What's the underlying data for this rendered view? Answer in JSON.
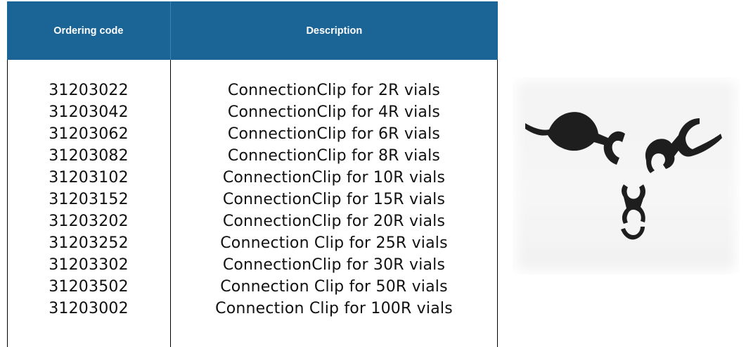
{
  "table": {
    "headers": {
      "ordering_code": "Ordering code",
      "description": "Description"
    },
    "rows": [
      {
        "code": "31203022",
        "description": "ConnectionClip for 2R vials"
      },
      {
        "code": "31203042",
        "description": "ConnectionClip for 4R vials"
      },
      {
        "code": "31203062",
        "description": "ConnectionClip for 6R vials"
      },
      {
        "code": "31203082",
        "description": "ConnectionClip for 8R vials"
      },
      {
        "code": "31203102",
        "description": "ConnectionClip for 10R vials"
      },
      {
        "code": "31203152",
        "description": "ConnectionClip for 15R vials"
      },
      {
        "code": "31203202",
        "description": "ConnectionClip for 20R vials"
      },
      {
        "code": "31203252",
        "description": "Connection Clip for 25R vials"
      },
      {
        "code": "31203302",
        "description": "ConnectionClip for 30R vials"
      },
      {
        "code": "31203502",
        "description": "Connection Clip for 50R vials"
      },
      {
        "code": "31203002",
        "description": "Connection Clip for 100R vials"
      }
    ]
  },
  "image": {
    "subject": "connection-clips-photo",
    "icon": "connection-clip-icon"
  },
  "colors": {
    "header_bg": "#1a6496",
    "header_text": "#ffffff",
    "body_text": "#111111",
    "clip_color": "#1e1e1e"
  }
}
